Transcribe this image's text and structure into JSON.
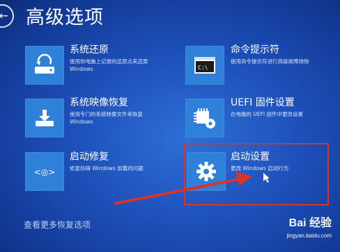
{
  "page": {
    "title": "高级选项",
    "more_link": "查看更多恢复选项"
  },
  "tiles": [
    {
      "name": "系统还原",
      "desc1": "使用你电脑上记录的还原点来还原",
      "desc2": "Windows",
      "icon": "system-restore-icon"
    },
    {
      "name": "命令提示符",
      "desc1": "使用命令提示符进行高级故障排除",
      "desc2": "",
      "icon": "command-prompt-icon"
    },
    {
      "name": "系统映像恢复",
      "desc1": "使用专门的系统映像文件来恢复",
      "desc2": "Windows",
      "icon": "system-image-icon"
    },
    {
      "name": "UEFI 固件设置",
      "desc1": "在电脑的 UEFI 固件中更改设置",
      "desc2": "",
      "icon": "uefi-chip-icon"
    },
    {
      "name": "启动修复",
      "desc1": "修复妨碍 Windows 加载的问题",
      "desc2": "",
      "icon": "startup-repair-icon"
    },
    {
      "name": "启动设置",
      "desc1": "更改 Windows 启动行为",
      "desc2": "",
      "icon": "startup-settings-gear-icon"
    }
  ],
  "watermark": {
    "brand": "Bai 经验",
    "url": "jingyan.baidu.com"
  },
  "colors": {
    "tile_icon_bg": "#2e80d8",
    "highlight": "#d9342b",
    "background": "#1d4fb8"
  }
}
